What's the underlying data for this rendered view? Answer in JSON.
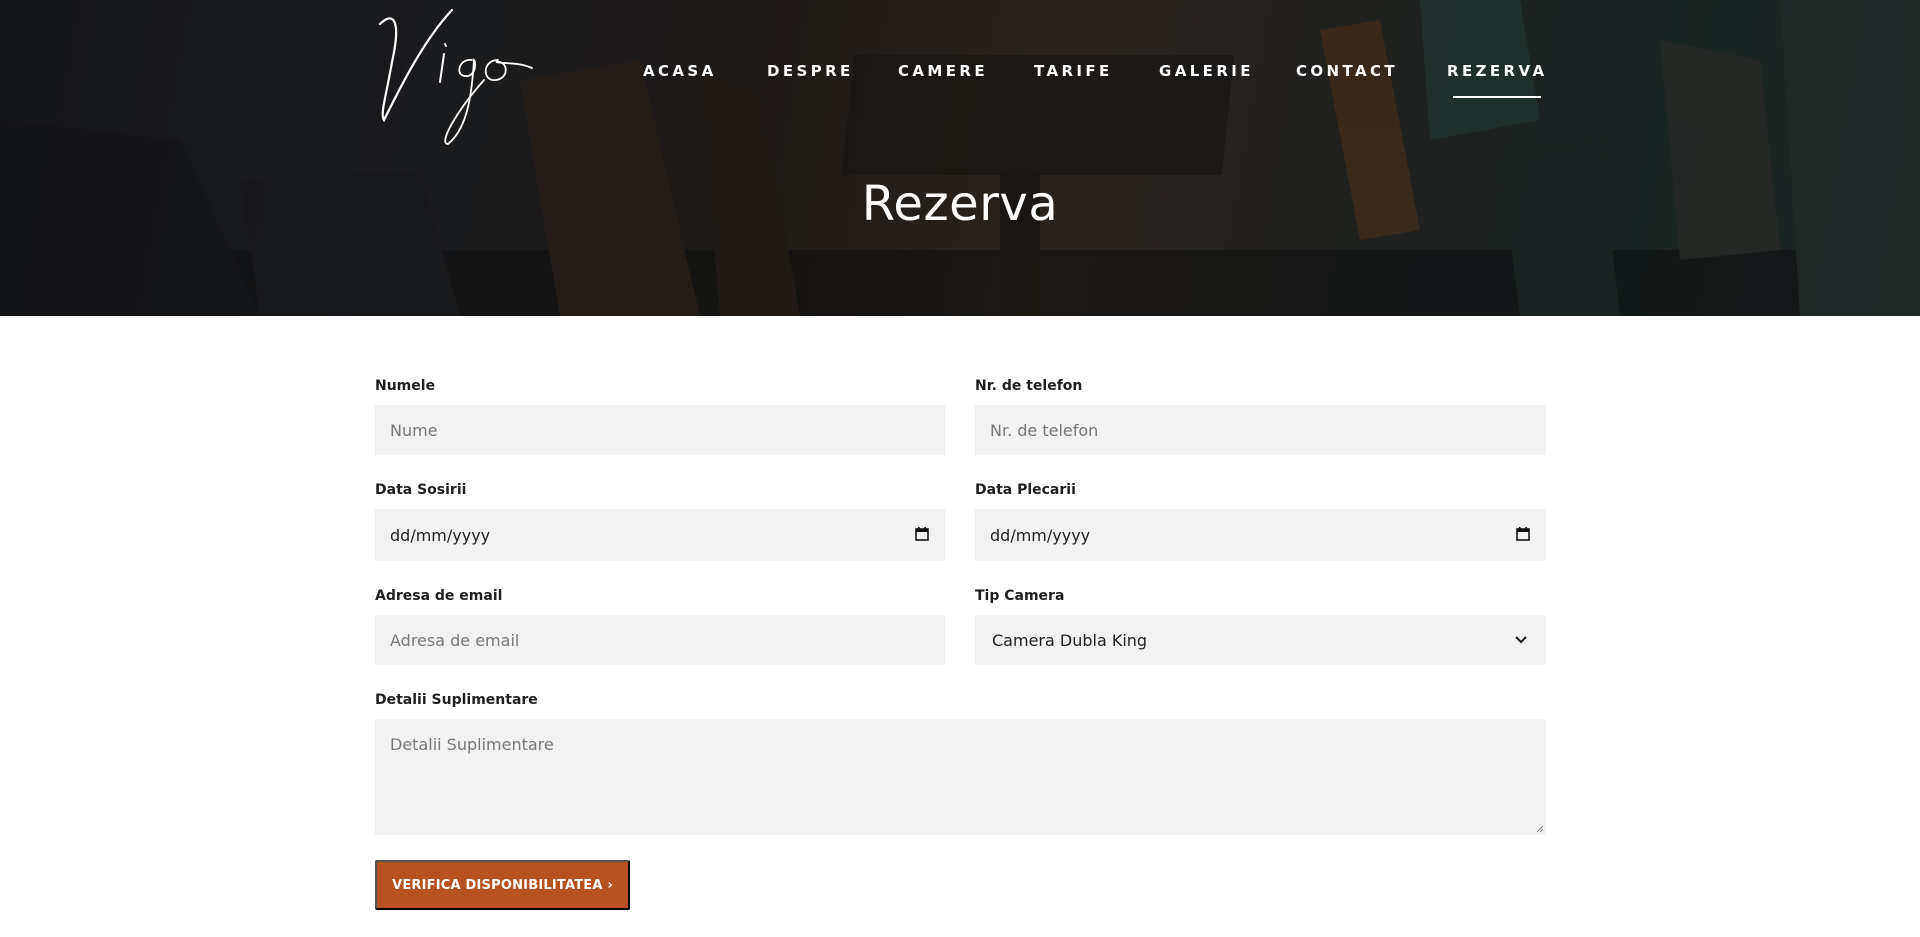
{
  "brand": {
    "logo_text": "Vigo"
  },
  "nav": {
    "items": [
      {
        "label": "ACASA",
        "active": false
      },
      {
        "label": "DESPRE",
        "active": false
      },
      {
        "label": "CAMERE",
        "active": false
      },
      {
        "label": "TARIFE",
        "active": false
      },
      {
        "label": "GALERIE",
        "active": false
      },
      {
        "label": "CONTACT",
        "active": false
      },
      {
        "label": "REZERVA",
        "active": true
      }
    ]
  },
  "hero": {
    "title": "Rezerva"
  },
  "form": {
    "name": {
      "label": "Numele",
      "placeholder": "Nume"
    },
    "phone": {
      "label": "Nr. de telefon",
      "placeholder": "Nr. de telefon"
    },
    "arrival": {
      "label": "Data Sosirii",
      "value": "dd/mm/yyyy"
    },
    "departure": {
      "label": "Data Plecarii",
      "value": "dd/mm/yyyy"
    },
    "email": {
      "label": "Adresa de email",
      "placeholder": "Adresa de email"
    },
    "room_type": {
      "label": "Tip Camera",
      "value": "Camera Dubla King"
    },
    "details": {
      "label": "Detalii Suplimentare",
      "placeholder": "Detalii Suplimentare"
    },
    "submit_label": "VERIFICA DISPONIBILITATEA ›"
  },
  "colors": {
    "accent": "#b6521f",
    "field_bg": "#f2f2f2"
  },
  "icons": {
    "date": "calendar-icon",
    "select": "chevron-down-icon"
  }
}
